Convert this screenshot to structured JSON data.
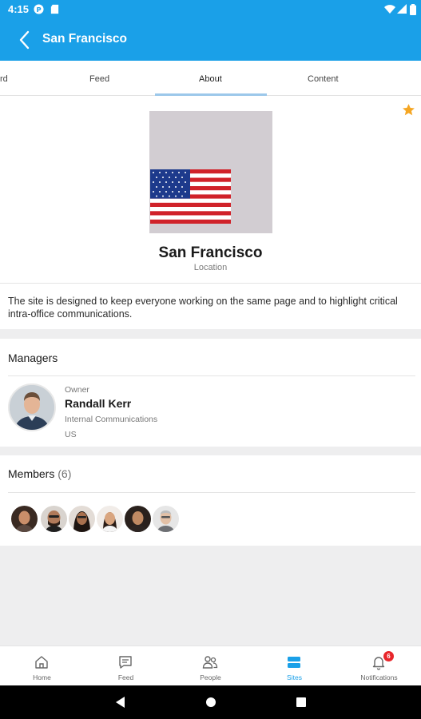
{
  "status_bar": {
    "time": "4:15"
  },
  "app_bar": {
    "title": "San Francisco"
  },
  "tabs": [
    {
      "label": "rd"
    },
    {
      "label": "Feed"
    },
    {
      "label": "About"
    },
    {
      "label": "Content"
    }
  ],
  "site": {
    "name": "San Francisco",
    "type": "Location",
    "description": "The site is designed to keep everyone working on the same page and to highlight critical intra-office communications."
  },
  "managers": {
    "title": "Managers",
    "owner": {
      "role": "Owner",
      "name": "Randall Kerr",
      "department": "Internal Communications",
      "country": "US"
    }
  },
  "members": {
    "title": "Members",
    "count": "(6)"
  },
  "bottom_nav": {
    "home": "Home",
    "feed": "Feed",
    "people": "People",
    "sites": "Sites",
    "notifications": "Notifications",
    "notification_count": "6"
  },
  "colors": {
    "accent": "#1aa0e8",
    "star": "#f5a623",
    "badge": "#e8262b"
  }
}
